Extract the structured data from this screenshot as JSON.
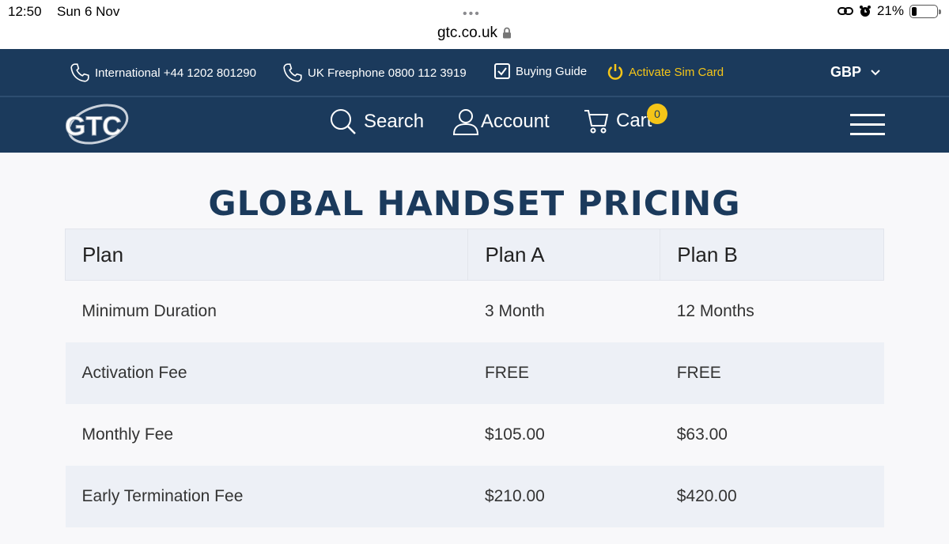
{
  "status_bar": {
    "time": "12:50",
    "date": "Sun 6 Nov",
    "battery_percent": "21%",
    "battery_level": 0.21
  },
  "address_bar": {
    "url": "gtc.co.uk"
  },
  "top_bar": {
    "international": "International +44 1202 801290",
    "uk_freephone": "UK Freephone 0800 112 3919",
    "buying_guide": "Buying Guide",
    "activate_sim": "Activate Sim Card",
    "currency": "GBP"
  },
  "nav": {
    "logo_text": "GTC",
    "search": "Search",
    "account": "Account",
    "cart": "Cart",
    "cart_count": "0"
  },
  "page": {
    "title": "GLOBAL HANDSET PRICING"
  },
  "pricing_table": {
    "headers": [
      "Plan",
      "Plan A",
      "Plan B"
    ],
    "rows": [
      [
        "Minimum Duration",
        "3 Month",
        "12 Months"
      ],
      [
        "Activation Fee",
        "FREE",
        "FREE"
      ],
      [
        "Monthly Fee",
        "$105.00",
        "$63.00"
      ],
      [
        "Early Termination Fee",
        "$210.00",
        "$420.00"
      ]
    ]
  },
  "colors": {
    "brand_navy": "#1b3a5c",
    "accent_yellow": "#f5c518",
    "row_alt": "#edf0f6"
  }
}
